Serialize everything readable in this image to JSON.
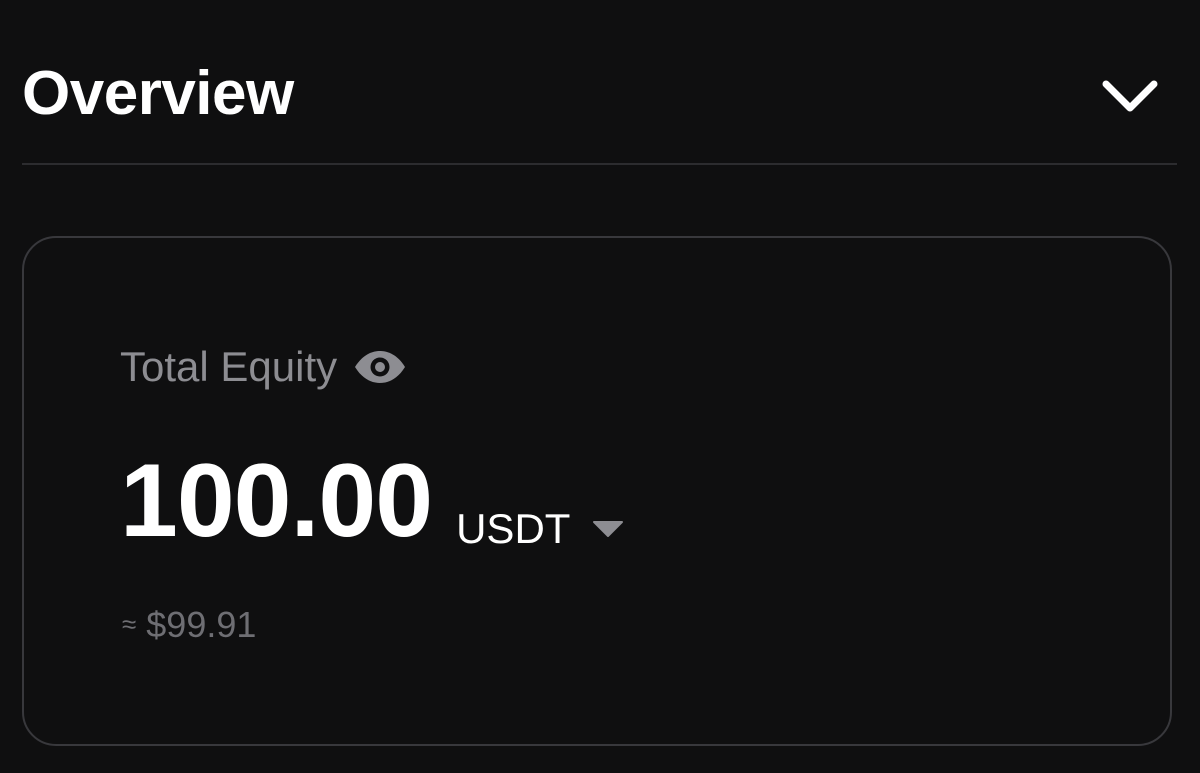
{
  "header": {
    "title": "Overview",
    "toggle_icon": "chevron-down-icon"
  },
  "equity": {
    "label": "Total Equity",
    "visibility_icon": "eye-icon",
    "amount": "100.00",
    "currency": "USDT",
    "currency_dropdown_icon": "caret-down-icon",
    "approx_symbol": "≈",
    "fiat_value": "$99.91"
  },
  "colors": {
    "background": "#0f0f10",
    "primary_text": "#ffffff",
    "secondary_text": "#8d8d92",
    "muted_text": "#6e6e73",
    "border": "#38383c",
    "divider": "#2c2c2f"
  }
}
